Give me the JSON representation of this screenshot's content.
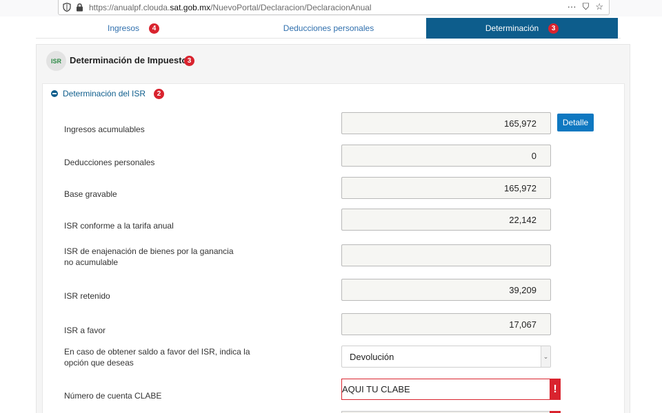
{
  "browser": {
    "url_prefix": "https://anualpf.clouda.",
    "url_domain": "sat.gob.mx",
    "url_path": "/NuevoPortal/Declaracion/DeclaracionAnual",
    "menu_icon": "···",
    "pocket_icon": "⛉",
    "star_icon": "☆"
  },
  "tabs": [
    {
      "label": "Ingresos",
      "badge": "4",
      "active": false
    },
    {
      "label": "Deducciones personales",
      "badge": "",
      "active": false
    },
    {
      "label": "Determinación",
      "badge": "3",
      "active": true
    }
  ],
  "section": {
    "icon_text": "ISR",
    "title": "Determinación de Impuesto",
    "badge": "3"
  },
  "panel": {
    "title": "Determinación del ISR",
    "badge": "2",
    "detail_button": "Detalle",
    "fields": [
      {
        "label": "Ingresos acumulables",
        "value": "165,972"
      },
      {
        "label": "Deducciones personales",
        "value": "0"
      },
      {
        "label": "Base gravable",
        "value": "165,972"
      },
      {
        "label": "ISR conforme a la tarifa anual",
        "value": "22,142"
      },
      {
        "label": "ISR de enajenación de bienes por la ganancia no acumulable",
        "value": ""
      },
      {
        "label": "ISR retenido",
        "value": "39,209"
      },
      {
        "label": "ISR a favor",
        "value": "17,067"
      }
    ],
    "option_label": "En caso de obtener saldo a favor del ISR, indica la opción que deseas",
    "option_value": "Devolución",
    "clabe_label": "Número de cuenta CLABE",
    "clabe_value": "AQUI TU CLABE",
    "error_mark": "!"
  },
  "colors": {
    "accent": "#0d5d8c",
    "button": "#0f78c1",
    "error": "#d9232e",
    "isr_text": "#2d8a46"
  }
}
